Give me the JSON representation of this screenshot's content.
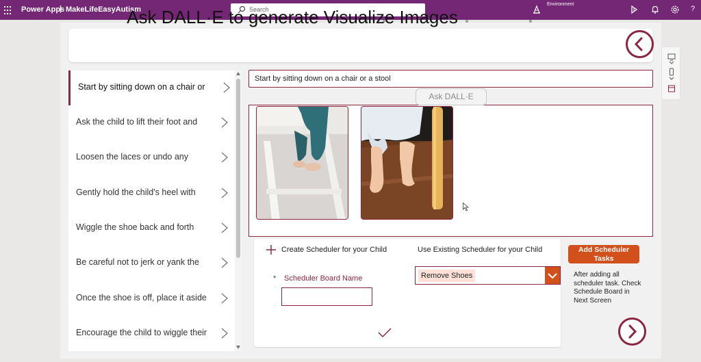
{
  "topbar": {
    "brand": "Power Apps",
    "separator": "|",
    "app_name": "MakeLifeEasyAutism",
    "search_placeholder": "Search",
    "environment_label": "Environment",
    "help": "?"
  },
  "header": {
    "title": "Ask DALL·E to generate  Visualize Images"
  },
  "steps": [
    {
      "label": "Start by sitting down on a chair or",
      "selected": true
    },
    {
      "label": "Ask the child to lift their foot and"
    },
    {
      "label": "Loosen the laces or undo any"
    },
    {
      "label": "Gently hold the child's heel with"
    },
    {
      "label": "Wiggle the shoe back and forth"
    },
    {
      "label": "Be careful not to jerk or yank the"
    },
    {
      "label": "Once the shoe is off, place it aside"
    },
    {
      "label": "Encourage the child to wiggle their"
    }
  ],
  "prompt": {
    "value": "Start by sitting down on a chair or a stool"
  },
  "ask_button": "Ask DALL·E",
  "scheduler": {
    "create_label": "Create Scheduler for your Child",
    "use_existing_label": "Use Existing Scheduler for your Child",
    "required_mark": "*",
    "board_name_label": "Scheduler Board Name",
    "board_name_value": "",
    "existing_selected": "Remove Shoes",
    "add_button": "Add Scheduler Tasks",
    "note": "After adding all scheduler task. Check Schedule Board in Next Screen"
  },
  "colors": {
    "header_purple": "#742774",
    "accent_maroon": "#8a2640",
    "accent_orange": "#d2501c",
    "selected_value_bg": "#fde1d8"
  }
}
